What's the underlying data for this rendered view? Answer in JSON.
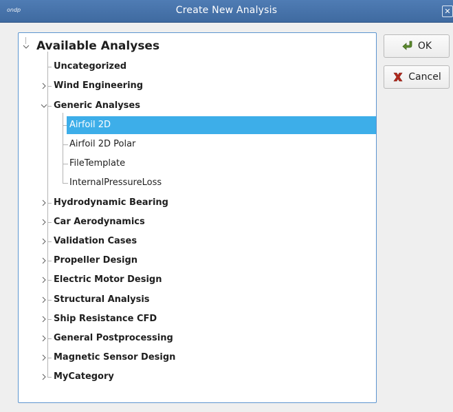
{
  "window": {
    "title": "Create New Analysis",
    "app_logo_text": "ondp",
    "close_glyph": "✕"
  },
  "tree": {
    "root_label": "Available Analyses",
    "items": [
      {
        "label": "Uncategorized",
        "expandable": false
      },
      {
        "label": "Wind Engineering",
        "expandable": true
      },
      {
        "label": "Generic Analyses",
        "expandable": true,
        "expanded": true,
        "children": [
          {
            "label": "Airfoil 2D",
            "selected": true
          },
          {
            "label": "Airfoil 2D Polar"
          },
          {
            "label": "FileTemplate"
          },
          {
            "label": "InternalPressureLoss"
          }
        ]
      },
      {
        "label": "Hydrodynamic Bearing",
        "expandable": true
      },
      {
        "label": "Car Aerodynamics",
        "expandable": true
      },
      {
        "label": "Validation Cases",
        "expandable": true
      },
      {
        "label": "Propeller Design",
        "expandable": true
      },
      {
        "label": "Electric Motor Design",
        "expandable": true
      },
      {
        "label": "Structural Analysis",
        "expandable": true
      },
      {
        "label": "Ship Resistance CFD",
        "expandable": true
      },
      {
        "label": "General Postprocessing",
        "expandable": true
      },
      {
        "label": "Magnetic Sensor Design",
        "expandable": true
      },
      {
        "label": "MyCategory",
        "expandable": true
      }
    ]
  },
  "buttons": {
    "ok_label": "OK",
    "cancel_label": "Cancel"
  },
  "colors": {
    "selection": "#3daee9",
    "titlebar": "#4f7cb4",
    "ok_icon": "#5c8a2c",
    "cancel_icon": "#b42a1e"
  },
  "icons": {
    "expand": "chevron-right-icon",
    "collapse": "chevron-down-icon",
    "ok": "check-arrow-icon",
    "cancel": "x-mark-icon"
  }
}
